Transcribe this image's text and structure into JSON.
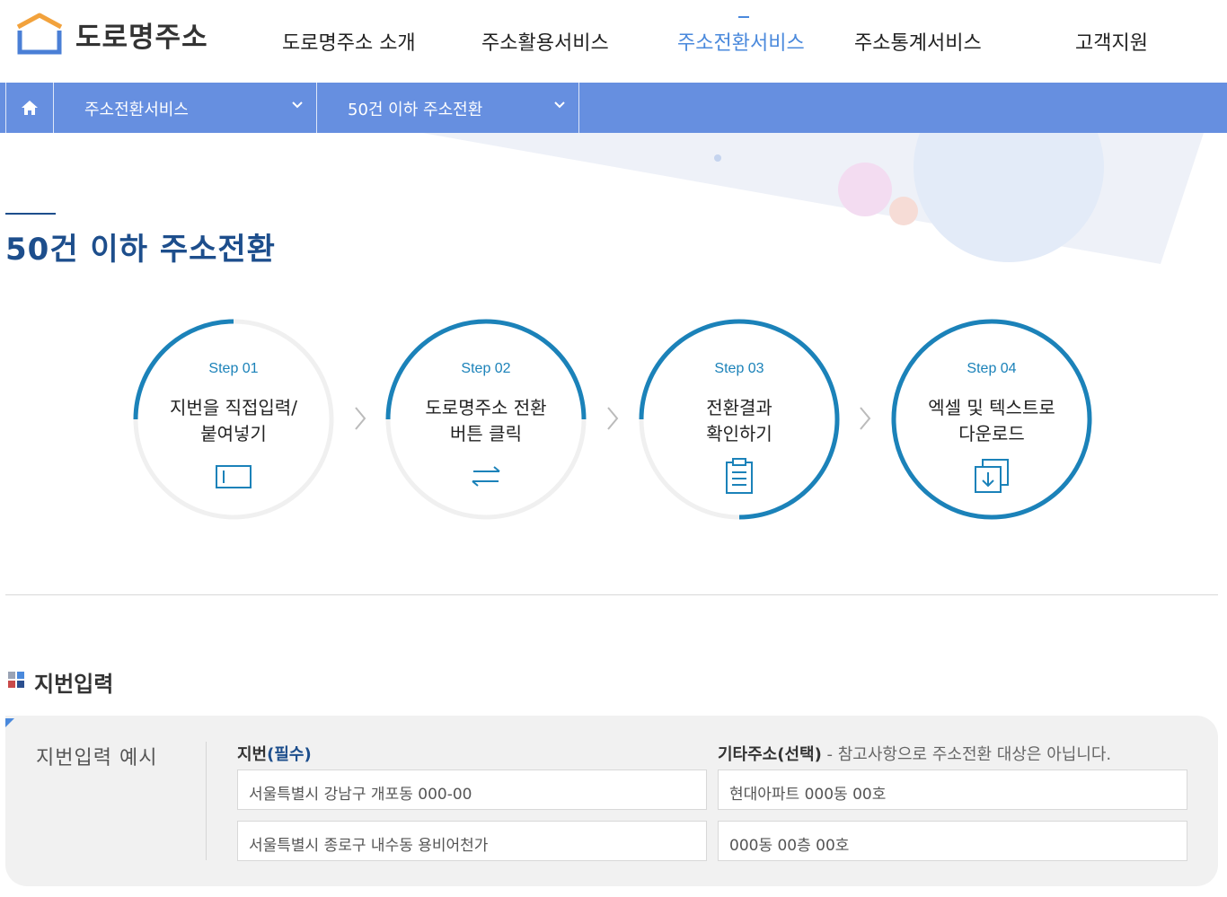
{
  "header": {
    "logo_text": "도로명주소",
    "nav": [
      {
        "label": "도로명주소 소개",
        "active": false
      },
      {
        "label": "주소활용서비스",
        "active": false
      },
      {
        "label": "주소전환서비스",
        "active": true
      },
      {
        "label": "주소통계서비스",
        "active": false
      },
      {
        "label": "고객지원",
        "active": false
      }
    ]
  },
  "breadcrumb": {
    "home_icon": "home-icon",
    "level1": "주소전환서비스",
    "level2": "50건 이하 주소전환"
  },
  "page_title": "50건 이하 주소전환",
  "steps": [
    {
      "no": "Step 01",
      "line1": "지번을 직접입력/",
      "line2": "붙여넣기",
      "icon": "input-box-icon",
      "progress": 0.25
    },
    {
      "no": "Step 02",
      "line1": "도로명주소 전환",
      "line2": "버튼 클릭",
      "icon": "swap-arrows-icon",
      "progress": 0.5
    },
    {
      "no": "Step 03",
      "line1": "전환결과",
      "line2": "확인하기",
      "icon": "clipboard-icon",
      "progress": 0.75
    },
    {
      "no": "Step 04",
      "line1": "엑셀 및 텍스트로",
      "line2": "다운로드",
      "icon": "download-icon",
      "progress": 1.0
    }
  ],
  "section": {
    "title": "지번입력",
    "example_label": "지번입력 예시",
    "col1_head": "지번",
    "col1_req": "(필수)",
    "col2_head": "기타주소(선택)",
    "col2_note": " - 참고사항으로 주소전환 대상은 아닙니다.",
    "rows": [
      {
        "jibun": "서울특별시 강남구 개포동 000-00",
        "etc": "현대아파트 000동 00호"
      },
      {
        "jibun": "서울특별시 종로구 내수동 용비어천가",
        "etc": "000동 00층 00호"
      }
    ]
  },
  "colors": {
    "accent": "#4a89dc",
    "crumb_bar": "#668fe0",
    "title": "#1d4e8c",
    "ring": "#1b82b9",
    "ring_track": "#f0f0f0"
  }
}
